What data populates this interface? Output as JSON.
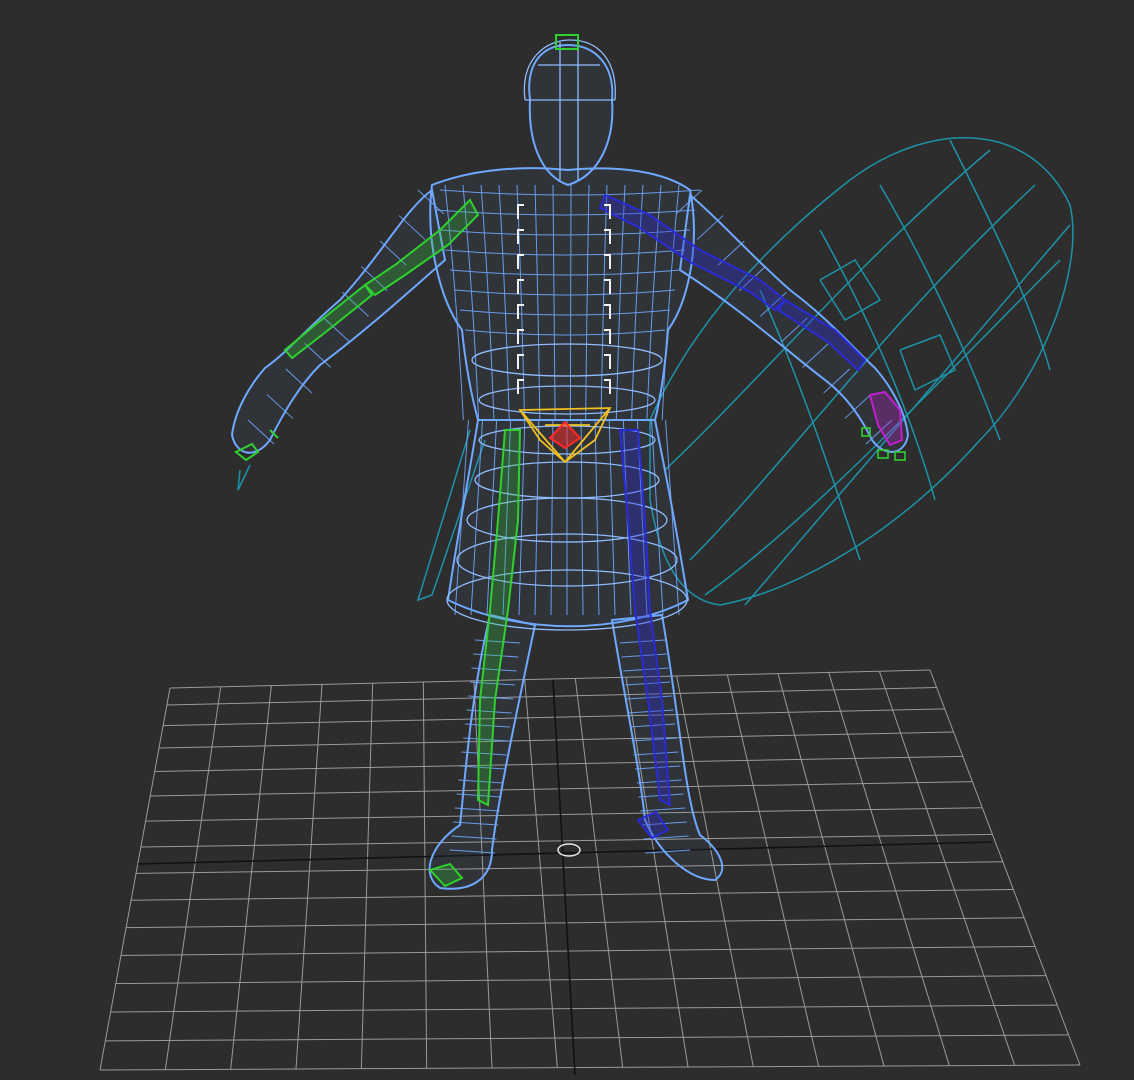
{
  "viewport": {
    "mode": "wireframe",
    "colors": {
      "background": "#2d2d2d",
      "grid": "#9a9a9a",
      "grid_axis": "#111111",
      "mesh": "#6fa8ff",
      "mesh_dark": "#4f86e0",
      "shield": "#1d93a8",
      "bone_left": "#2fd02f",
      "bone_right": "#2b2bd6",
      "spine_markers": "#f2f2f2",
      "pelvis": "#f0c020",
      "root": "#ff2a2a",
      "hand_right": "#c020d0"
    }
  },
  "scene": {
    "objects": [
      "character-mesh",
      "shield-mesh",
      "biped-rig",
      "ground-grid",
      "origin-marker"
    ]
  }
}
